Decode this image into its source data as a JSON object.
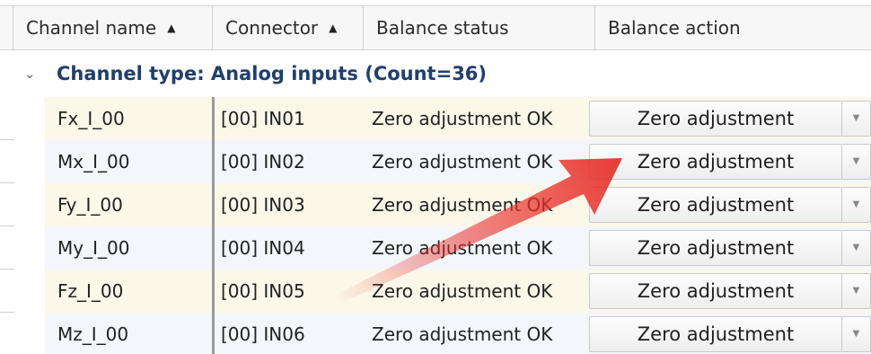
{
  "header": {
    "columns": [
      {
        "label": "Channel name",
        "sort_icon": "▲"
      },
      {
        "label": "Connector",
        "sort_icon": "▲"
      },
      {
        "label": "Balance status",
        "sort_icon": ""
      },
      {
        "label": "Balance action",
        "sort_icon": ""
      }
    ]
  },
  "group": {
    "chevron_icon": "chevron-down-icon",
    "chevron_glyph": "⌄",
    "label": "Channel type: Analog inputs (Count=36)"
  },
  "rows": [
    {
      "channel": "Fx_I_00",
      "connector": "[00] IN01",
      "status": "Zero adjustment OK",
      "action": "Zero adjustment",
      "dropdown": "▼"
    },
    {
      "channel": "Mx_I_00",
      "connector": "[00] IN02",
      "status": "Zero adjustment OK",
      "action": "Zero adjustment",
      "dropdown": "▼"
    },
    {
      "channel": "Fy_I_00",
      "connector": "[00] IN03",
      "status": "Zero adjustment OK",
      "action": "Zero adjustment",
      "dropdown": "▼"
    },
    {
      "channel": "My_I_00",
      "connector": "[00] IN04",
      "status": "Zero adjustment OK",
      "action": "Zero adjustment",
      "dropdown": "▼"
    },
    {
      "channel": "Fz_I_00",
      "connector": "[00] IN05",
      "status": "Zero adjustment OK",
      "action": "Zero adjustment",
      "dropdown": "▼"
    },
    {
      "channel": "Mz_I_00",
      "connector": "[00] IN06",
      "status": "Zero adjustment OK",
      "action": "Zero adjustment",
      "dropdown": "▼"
    }
  ],
  "colors": {
    "group_text": "#1f3f6f",
    "row_odd": "#fbf8ea",
    "row_even": "#f3f6fb",
    "arrow": "#e8322c"
  }
}
